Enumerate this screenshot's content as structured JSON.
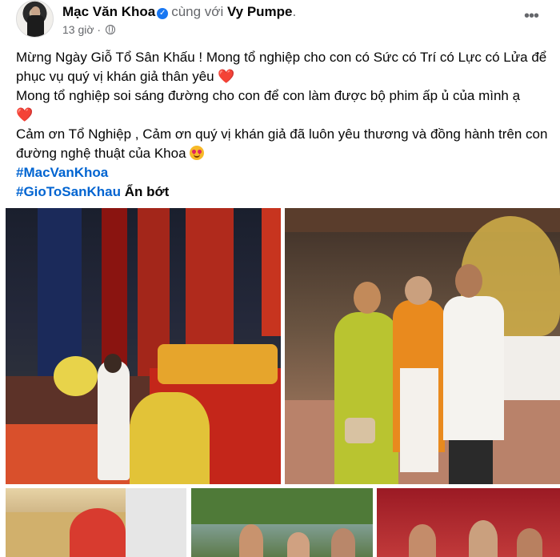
{
  "post": {
    "author": "Mạc Văn Khoa",
    "with_text": "cùng với",
    "tagged": "Vy Pumpe",
    "time": "13 giờ",
    "more_icon": "more-horizontal-icon",
    "verified_icon": "verified-badge-icon",
    "audience_icon": "globe-icon",
    "line1": "Mừng Ngày Giỗ Tổ Sân Khấu ! Mong tổ nghiệp cho con có Sức có Trí có Lực có Lửa để phục vụ quý vị khán giả thân yêu",
    "line2": "Mong tổ nghiệp soi sáng đường cho con để con làm được bộ phim ấp ủ của mình ạ",
    "line3": "Cảm ơn Tổ Nghiệp , Cảm ơn quý vị khán giả đã luôn yêu thương và đồng hành trên con đường nghệ thuật của Khoa",
    "hashtag1": "#MacVanKhoa",
    "hashtag2": "#GioToSanKhau",
    "see_less": "Ẩn bớt",
    "heart_glyph": "❤️"
  },
  "photos": [
    {
      "name": "altar-offering-photo"
    },
    {
      "name": "group-temple-photo"
    },
    {
      "name": "altar-flowers-photo"
    },
    {
      "name": "crowd-outdoor-photo"
    },
    {
      "name": "group-red-backdrop-photo"
    }
  ],
  "colors": {
    "link": "#0064d1",
    "verified": "#1877f2",
    "secondary_text": "#65676b"
  }
}
